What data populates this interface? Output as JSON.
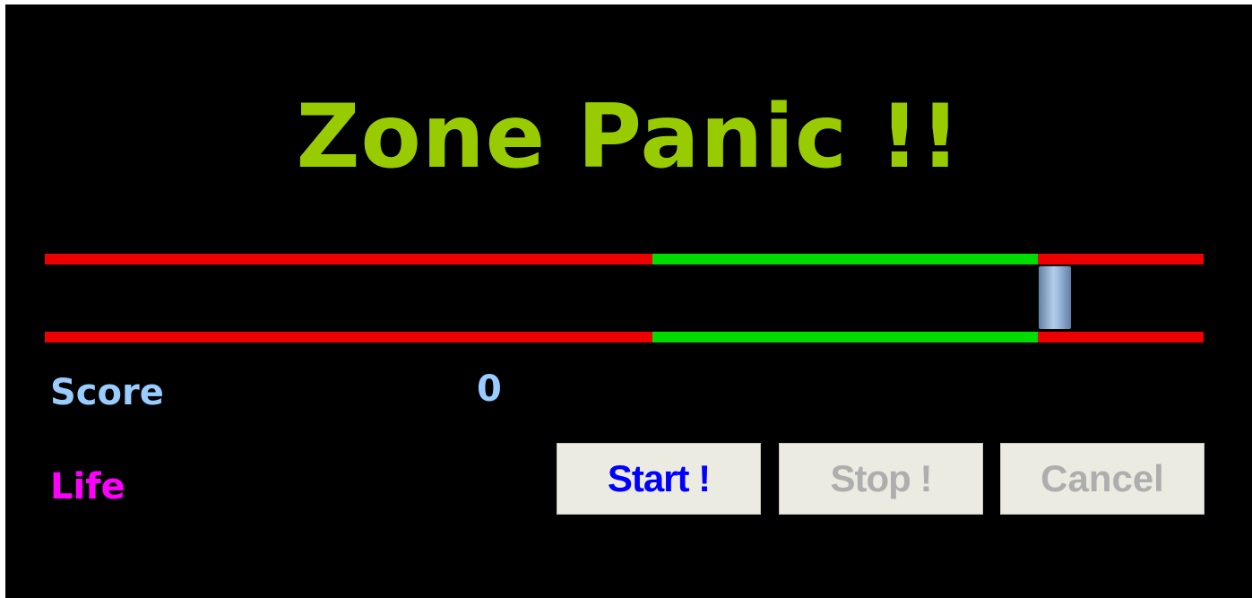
{
  "title": "Zone Panic !!",
  "track": {
    "safe_zone_start": 0.524,
    "safe_zone_end": 0.857,
    "marker_position": 0.872
  },
  "score": {
    "label": "Score",
    "value": "0"
  },
  "life": {
    "label": "Life"
  },
  "buttons": {
    "start_label": "Start !",
    "stop_label": "Stop !",
    "cancel_label": "Cancel"
  },
  "colors": {
    "background": "#000000",
    "title": "#99cc00",
    "danger_line": "#ee0000",
    "safe_line": "#00dd00",
    "score": "#99ccff",
    "life": "#ff00ff",
    "button_active": "#0000ff",
    "button_disabled": "#aeaeae",
    "button_face": "#ecebe2"
  }
}
